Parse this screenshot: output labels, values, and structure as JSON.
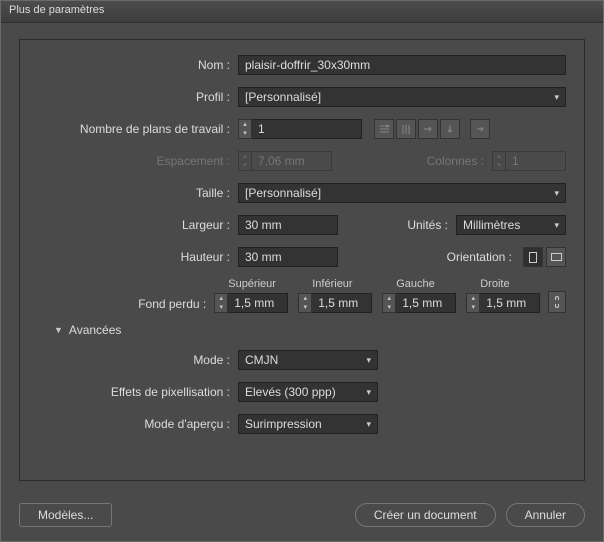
{
  "window": {
    "title": "Plus de paramètres"
  },
  "labels": {
    "nom": "Nom :",
    "profil": "Profil :",
    "artboards": "Nombre de plans de travail :",
    "spacing": "Espacement :",
    "columns": "Colonnes :",
    "size": "Taille :",
    "width": "Largeur :",
    "height": "Hauteur :",
    "units": "Unités :",
    "orientation": "Orientation :",
    "bleed": "Fond perdu :",
    "top": "Supérieur",
    "bottom": "Inférieur",
    "left": "Gauche",
    "right": "Droite",
    "advanced": "Avancées",
    "mode": "Mode :",
    "raster": "Effets de pixellisation :",
    "preview": "Mode d'aperçu :"
  },
  "values": {
    "nom": "plaisir-doffrir_30x30mm",
    "profil": "[Personnalisé]",
    "artboards": "1",
    "spacing": "7,06 mm",
    "columns": "1",
    "size": "[Personnalisé]",
    "width": "30 mm",
    "height": "30 mm",
    "units": "Millimètres",
    "bleed_top": "1,5 mm",
    "bleed_bottom": "1,5 mm",
    "bleed_left": "1,5 mm",
    "bleed_right": "1,5 mm",
    "mode": "CMJN",
    "raster": "Elevés (300 ppp)",
    "preview": "Surimpression"
  },
  "buttons": {
    "templates": "Modèles...",
    "create": "Créer un document",
    "cancel": "Annuler"
  }
}
